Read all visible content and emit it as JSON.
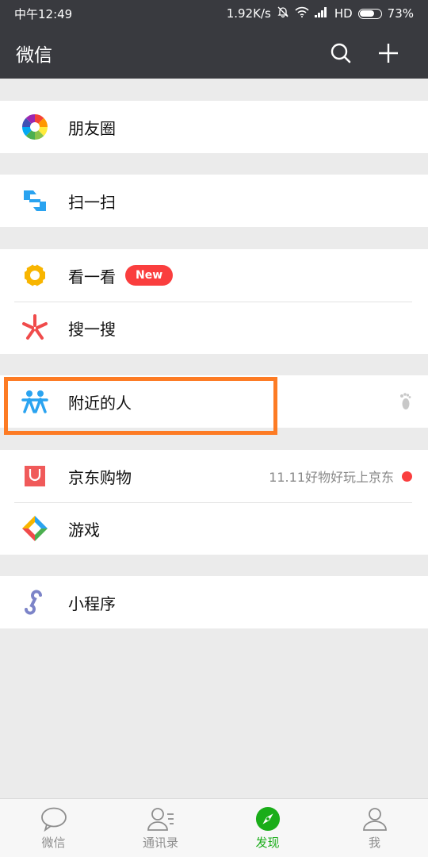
{
  "status_bar": {
    "time": "中午12:49",
    "speed": "1.92K/s",
    "network": "HD",
    "battery": "73%",
    "battery_level": 0.73
  },
  "header": {
    "title": "微信",
    "search_icon": "search-icon",
    "add_icon": "plus-icon"
  },
  "menu": {
    "moments": {
      "label": "朋友圈",
      "icon": "moments-aperture-icon"
    },
    "scan": {
      "label": "扫一扫",
      "icon": "scan-icon"
    },
    "top_stories": {
      "label": "看一看",
      "badge": "New",
      "icon": "top-stories-icon"
    },
    "search": {
      "label": "搜一搜",
      "icon": "search-asterisk-icon"
    },
    "nearby": {
      "label": "附近的人",
      "icon": "people-nearby-icon",
      "right_icon": "footprint-icon"
    },
    "jd_shopping": {
      "label": "京东购物",
      "promo": "11.11好物好玩上京东",
      "icon": "shopping-bag-icon"
    },
    "games": {
      "label": "游戏",
      "icon": "games-diamond-icon"
    },
    "mini_programs": {
      "label": "小程序",
      "icon": "mini-program-icon"
    }
  },
  "tabs": [
    {
      "label": "微信",
      "icon": "chat-icon",
      "active": false
    },
    {
      "label": "通讯录",
      "icon": "contacts-icon",
      "active": false
    },
    {
      "label": "发现",
      "icon": "compass-icon",
      "active": true
    },
    {
      "label": "我",
      "icon": "profile-icon",
      "active": false
    }
  ],
  "colors": {
    "header_bg": "#393a3f",
    "page_bg": "#ebebeb",
    "accent_green": "#1aad19",
    "badge_red": "#fa3e3e",
    "highlight_orange": "#fd7b24"
  }
}
